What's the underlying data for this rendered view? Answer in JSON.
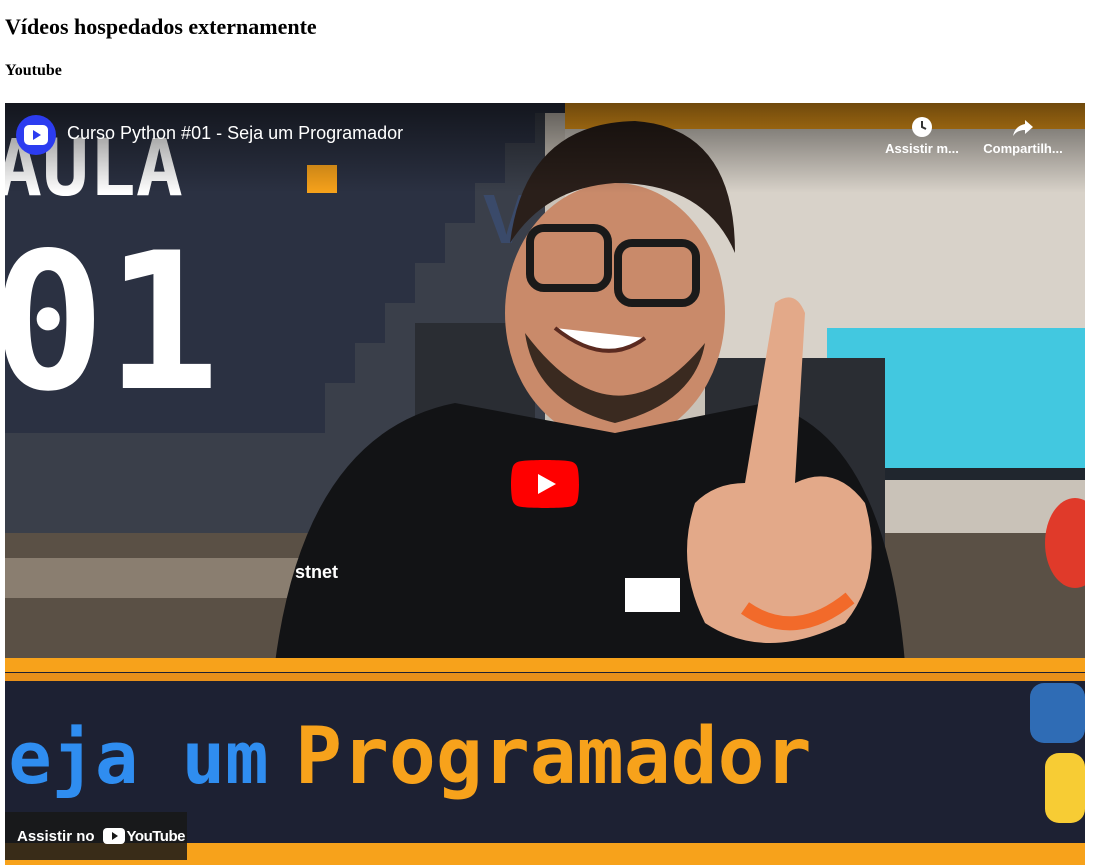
{
  "page": {
    "heading": "Vídeos hospedados externamente",
    "section_heading": "Youtube"
  },
  "video": {
    "title": "Curso Python #01 - Seja um Programador",
    "channel_icon": "channel-avatar-icon",
    "actions": [
      {
        "label": "Assistir m...",
        "icon": "clock-icon"
      },
      {
        "label": "Compartilh...",
        "icon": "share-arrow-icon"
      }
    ],
    "play_icon": "play-icon",
    "watch_on_label": "Assistir no",
    "watch_on_brand": "YouTube",
    "thumbnail": {
      "aula_text": "AULA",
      "number_text": "01",
      "banner_left": "Seja um",
      "banner_right": "Programador",
      "logo_letter": "V",
      "shirt_text": "stnet"
    },
    "colors": {
      "accent_orange": "#f7a21b",
      "banner_blue": "#2f8df0",
      "yt_red": "#ff0000",
      "panel_dark": "#1b1f2b"
    }
  }
}
